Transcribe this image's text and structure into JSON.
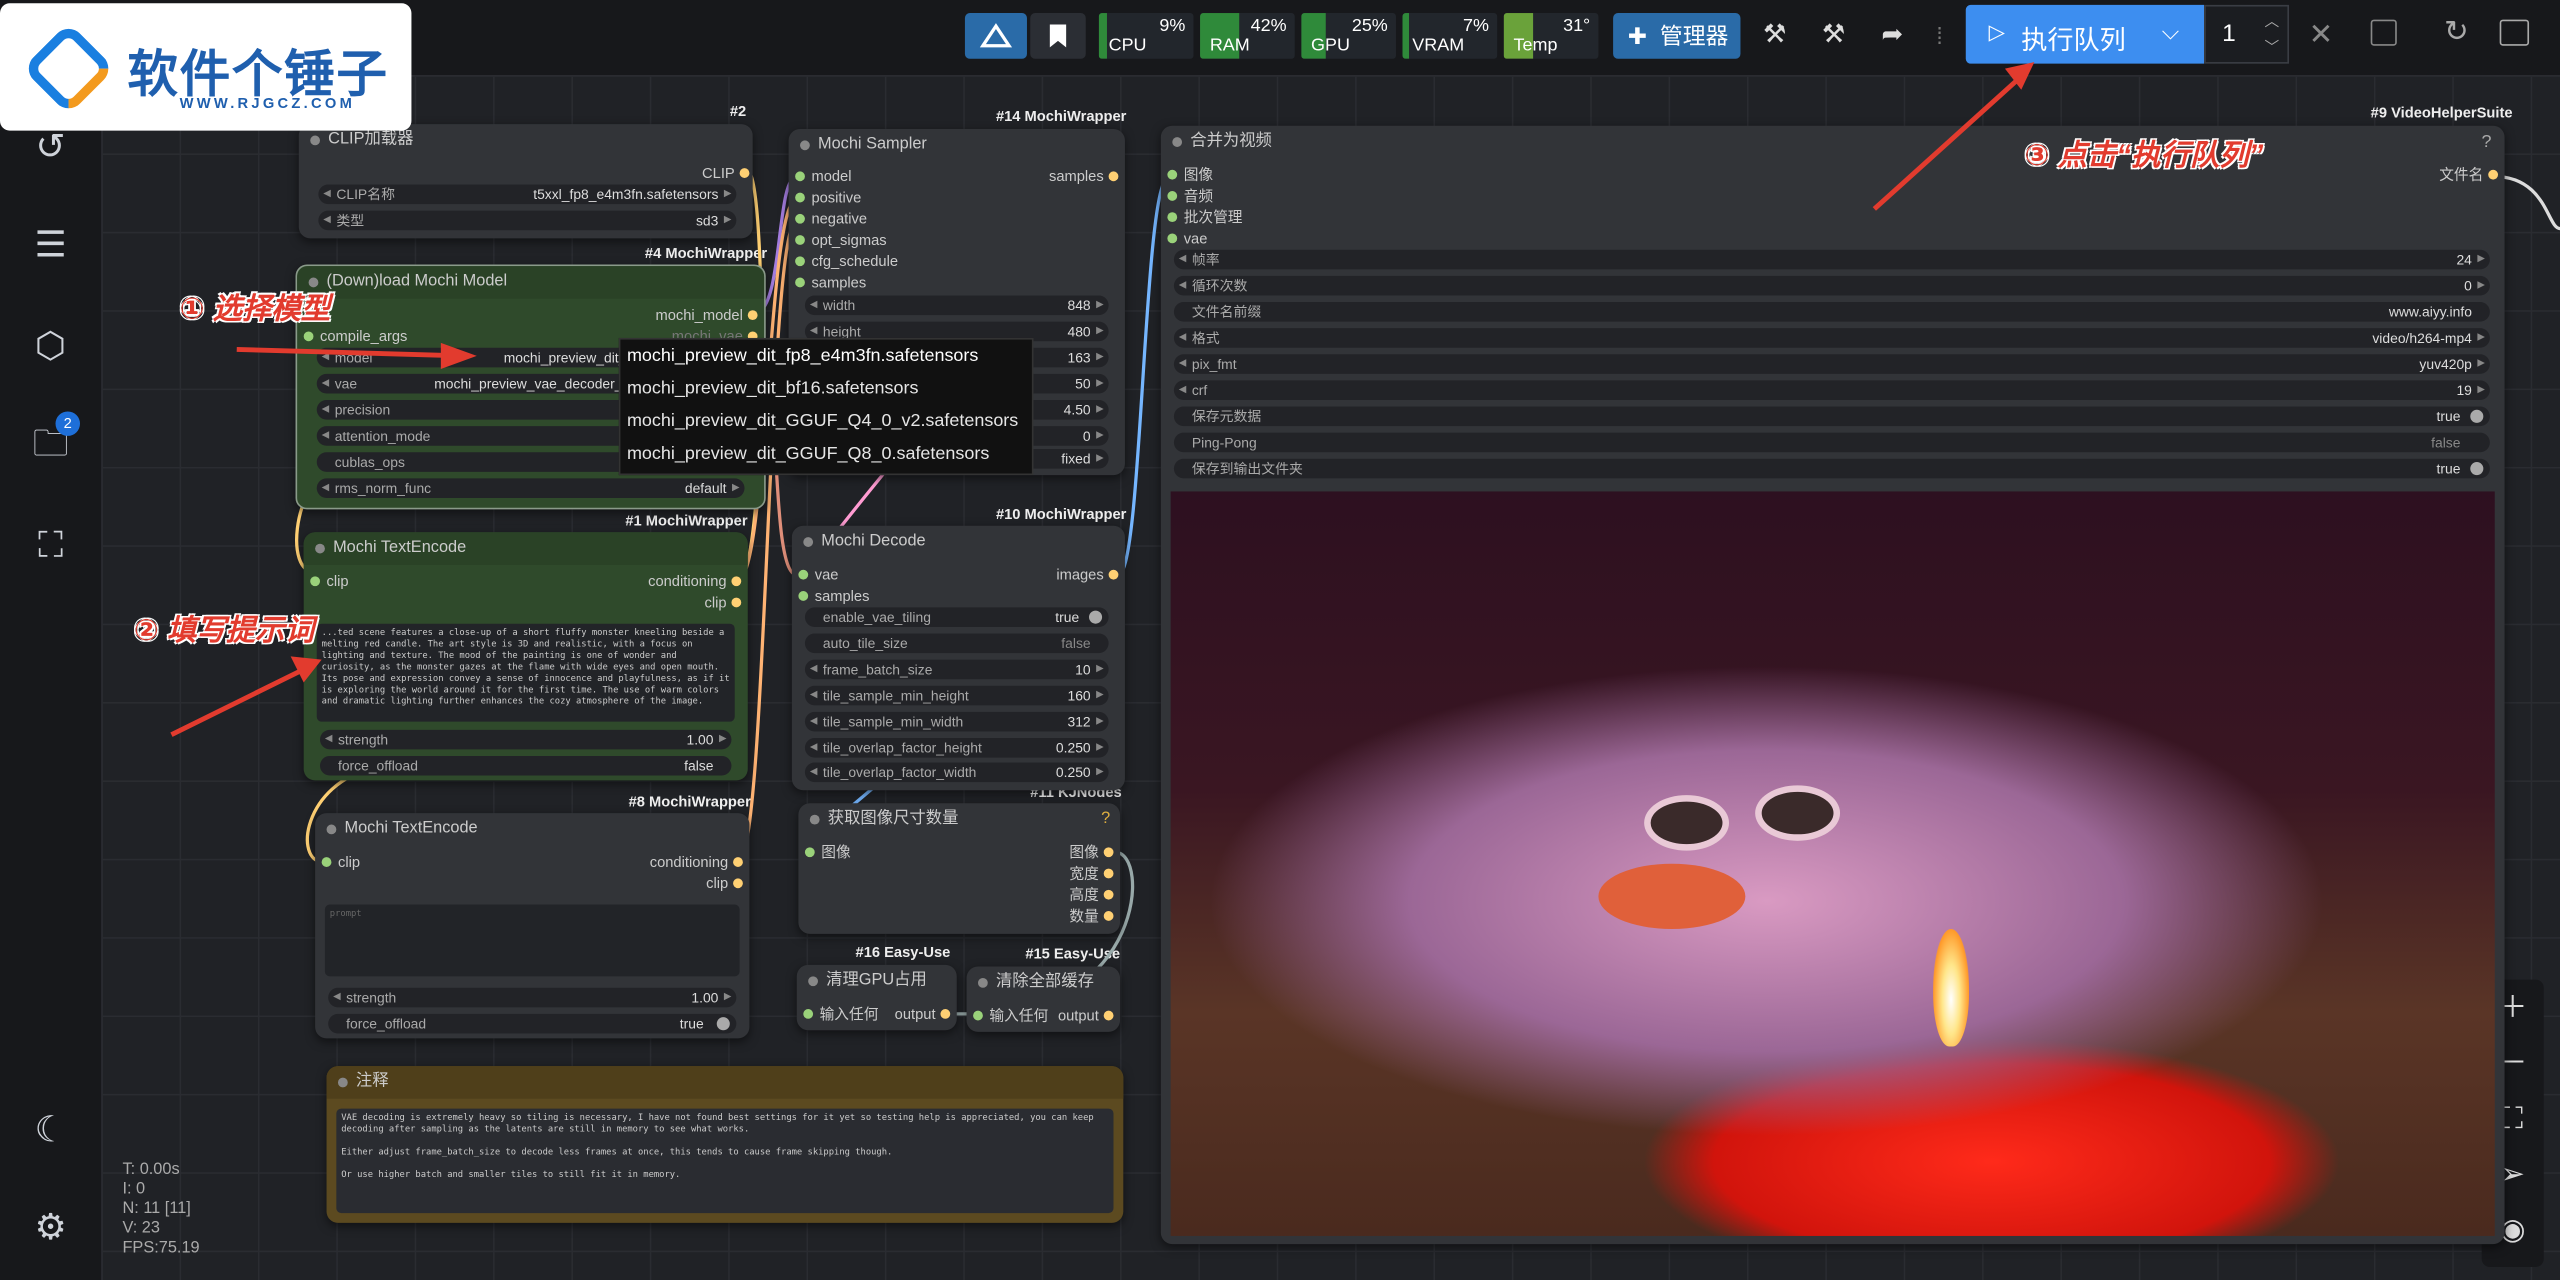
{
  "logo": {
    "title": "软件个锤子",
    "subtitle": "WWW.RJGCZ.COM"
  },
  "topbar": {
    "meters": [
      {
        "label": "CPU",
        "value": "9%",
        "fill": 0.09,
        "color": "#2f8a3a"
      },
      {
        "label": "RAM",
        "value": "42%",
        "fill": 0.42,
        "color": "#2f8a3a"
      },
      {
        "label": "GPU",
        "value": "25%",
        "fill": 0.25,
        "color": "#2f8a3a"
      },
      {
        "label": "VRAM",
        "value": "7%",
        "fill": 0.07,
        "color": "#2f8a3a"
      },
      {
        "label": "Temp",
        "value": "31°",
        "fill": 0.31,
        "color": "#6aa23a"
      }
    ],
    "manager_label": "管理器",
    "run_label": "执行队列",
    "queue_count": "1"
  },
  "sidebar": {
    "badge": "2"
  },
  "nodes": {
    "clip_loader": {
      "tag": "#2",
      "title": "CLIP加载器",
      "out": "CLIP",
      "w1_label": "CLIP名称",
      "w1_value": "t5xxl_fp8_e4m3fn.safetensors",
      "w2_label": "类型",
      "w2_value": "sd3"
    },
    "download": {
      "tag": "#4 MochiWrapper",
      "title": "(Down)load Mochi Model",
      "in": "compile_args",
      "out1": "mochi_model",
      "out2": "mochi_vae",
      "w_model_label": "model",
      "w_model_value": "mochi_preview_dit_f",
      "w_vae_label": "vae",
      "w_vae_value": "mochi_preview_vae_decoder_b",
      "w_prec_label": "precision",
      "w_attn_label": "attention_mode",
      "w_cublas_label": "cublas_ops",
      "w_rms_label": "rms_norm_func",
      "w_rms_value": "default"
    },
    "sampler": {
      "tag": "#14 MochiWrapper",
      "title": "Mochi Sampler",
      "out": "samples",
      "ins": [
        "model",
        "positive",
        "negative",
        "opt_sigmas",
        "cfg_schedule",
        "samples"
      ],
      "widgets": [
        {
          "l": "width",
          "v": "848"
        },
        {
          "l": "height",
          "v": "480"
        },
        {
          "l": "",
          "v": "163"
        },
        {
          "l": "",
          "v": "50"
        },
        {
          "l": "",
          "v": "4.50"
        },
        {
          "l": "",
          "v": "0"
        },
        {
          "l": "",
          "v": "fixed"
        }
      ]
    },
    "text1": {
      "tag": "#1 MochiWrapper",
      "title": "Mochi TextEncode",
      "in": "clip",
      "out1": "conditioning",
      "out2": "clip",
      "prompt": "...ted scene features a close-up of a short fluffy monster kneeling beside a melting red candle. The art style is 3D and realistic, with a focus on lighting and texture. The mood of the painting is one of wonder and curiosity, as the monster gazes at the flame with wide eyes and open mouth. Its pose and expression convey a sense of innocence and playfulness, as if it is exploring the world around it for the first time. The use of warm colors and dramatic lighting further enhances the cozy atmosphere of the image.",
      "strength_label": "strength",
      "strength_value": "1.00",
      "offload_label": "force_offload",
      "offload_value": "false"
    },
    "text2": {
      "tag": "#8 MochiWrapper",
      "title": "Mochi TextEncode",
      "in": "clip",
      "out1": "conditioning",
      "out2": "clip",
      "prompt": "prompt",
      "strength_label": "strength",
      "strength_value": "1.00",
      "offload_label": "force_offload",
      "offload_value": "true"
    },
    "decode": {
      "tag": "#10 MochiWrapper",
      "title": "Mochi Decode",
      "ins": [
        "vae",
        "samples"
      ],
      "out": "images",
      "widgets": [
        {
          "l": "enable_vae_tiling",
          "v": "true"
        },
        {
          "l": "auto_tile_size",
          "v": "false"
        },
        {
          "l": "frame_batch_size",
          "v": "10"
        },
        {
          "l": "tile_sample_min_height",
          "v": "160"
        },
        {
          "l": "tile_sample_min_width",
          "v": "312"
        },
        {
          "l": "tile_overlap_factor_height",
          "v": "0.250"
        },
        {
          "l": "tile_overlap_factor_width",
          "v": "0.250"
        }
      ]
    },
    "imgsize": {
      "tag": "#11 KJNodes",
      "title": "获取图像尺寸数量",
      "in": "图像",
      "outs": [
        "图像",
        "宽度",
        "高度",
        "数量"
      ]
    },
    "gpu": {
      "tag": "#16 Easy-Use",
      "title": "清理GPU占用",
      "in": "输入任何",
      "out": "output"
    },
    "cache": {
      "tag": "#15 Easy-Use",
      "title": "清除全部缓存",
      "in": "输入任何",
      "out": "output"
    },
    "note": {
      "title": "注释",
      "text": "VAE decoding is extremely heavy so tiling is necessary, I have not found best settings for it yet so testing help is appreciated, you can keep decoding after sampling as the latents are still in memory to see what works.\n\nEither adjust frame_batch_size to decode less frames at once, this tends to cause frame skipping though.\n\nOr use higher batch and smaller tiles to still fit it in memory."
    },
    "video": {
      "tag": "#9 VideoHelperSuite",
      "title": "合并为视频",
      "ins": [
        "图像",
        "音频",
        "批次管理",
        "vae"
      ],
      "out": "文件名",
      "q": "?",
      "widgets": [
        {
          "l": "帧率",
          "v": "24"
        },
        {
          "l": "循环次数",
          "v": "0"
        },
        {
          "l": "文件名前缀",
          "v": "www.aiyy.info"
        },
        {
          "l": "格式",
          "v": "video/h264-mp4"
        },
        {
          "l": "pix_fmt",
          "v": "yuv420p"
        },
        {
          "l": "crf",
          "v": "19"
        },
        {
          "l": "保存元数据",
          "v": "true"
        },
        {
          "l": "Ping-Pong",
          "v": "false"
        },
        {
          "l": "保存到输出文件夹",
          "v": "true"
        }
      ]
    }
  },
  "dropdown": [
    "mochi_preview_dit_fp8_e4m3fn.safetensors",
    "mochi_preview_dit_bf16.safetensors",
    "mochi_preview_dit_GGUF_Q4_0_v2.safetensors",
    "mochi_preview_dit_GGUF_Q8_0.safetensors"
  ],
  "annotations": {
    "a1": "① 选择模型",
    "a2": "② 填写提示词",
    "a3": "③ 点击“执行队列”"
  },
  "stats": [
    "T: 0.00s",
    "I: 0",
    "N: 11 [11]",
    "V: 23",
    "FPS:75.19"
  ]
}
